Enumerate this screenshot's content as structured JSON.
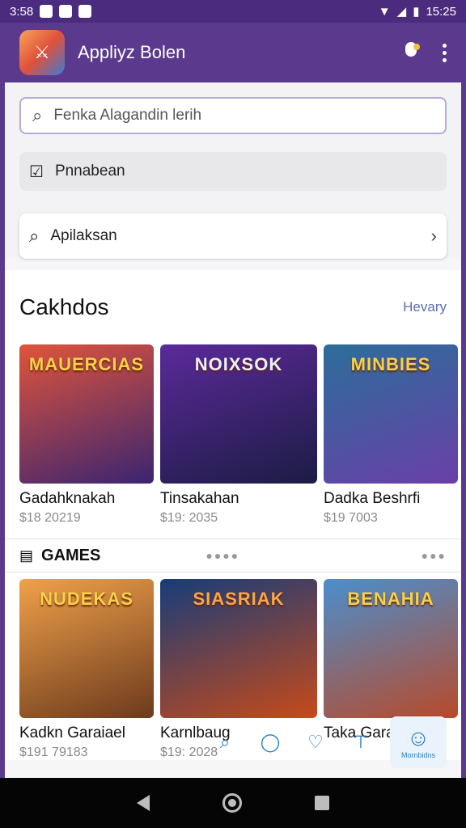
{
  "status_bar": {
    "time": "3:58",
    "right_time": "15:25",
    "icons": [
      "notification-icon",
      "photo-icon",
      "message-icon",
      "wifi-icon",
      "signal-icon",
      "battery-icon"
    ]
  },
  "app_bar": {
    "title": "Appliyz Bolen",
    "logo_icon": "game-logo-icon",
    "actions": [
      "mic-icon",
      "more-vert-icon"
    ]
  },
  "search": {
    "placeholder": "Fenka Alagandin lerih",
    "pill_label": "Pnnabean",
    "row_label": "Apilaksan"
  },
  "section": {
    "title": "Cakhdos",
    "more_label": "Hevary",
    "items": [
      {
        "art_title": "MAUERCIAS",
        "name": "Gadahknakah",
        "meta": "$18 20219",
        "colors": [
          "#e0543b",
          "#3a2470"
        ]
      },
      {
        "art_title": "NOIXSOK",
        "name": "Tinsakahan",
        "meta": "$19: 2035",
        "colors": [
          "#5b2a9a",
          "#1c1c44"
        ]
      },
      {
        "art_title": "MINBIES",
        "name": "Dadka Beshrfi",
        "meta": "$19 7003",
        "colors": [
          "#2c6e9a",
          "#6a3fa8"
        ]
      }
    ]
  },
  "games": {
    "title": "GAMES",
    "items": [
      {
        "art_title": "NUDEKAS",
        "name": "Kadkn Garaiael",
        "meta": "$191 79183",
        "colors": [
          "#f0a14a",
          "#6c3a1c"
        ]
      },
      {
        "art_title": "SIASRIAK",
        "name": "Karnlbaug",
        "meta": "$19: 2028",
        "colors": [
          "#173c7a",
          "#c64a1a"
        ]
      },
      {
        "art_title": "BENAHIA",
        "name": "Taka Garahov",
        "meta": "",
        "colors": [
          "#4a8fce",
          "#b84a2a"
        ]
      }
    ]
  },
  "bottom_tabs": {
    "active_label": "Mornbidns"
  },
  "colors": {
    "brand_purple": "#5b3a8e",
    "link_blue": "#5a6fb5"
  }
}
